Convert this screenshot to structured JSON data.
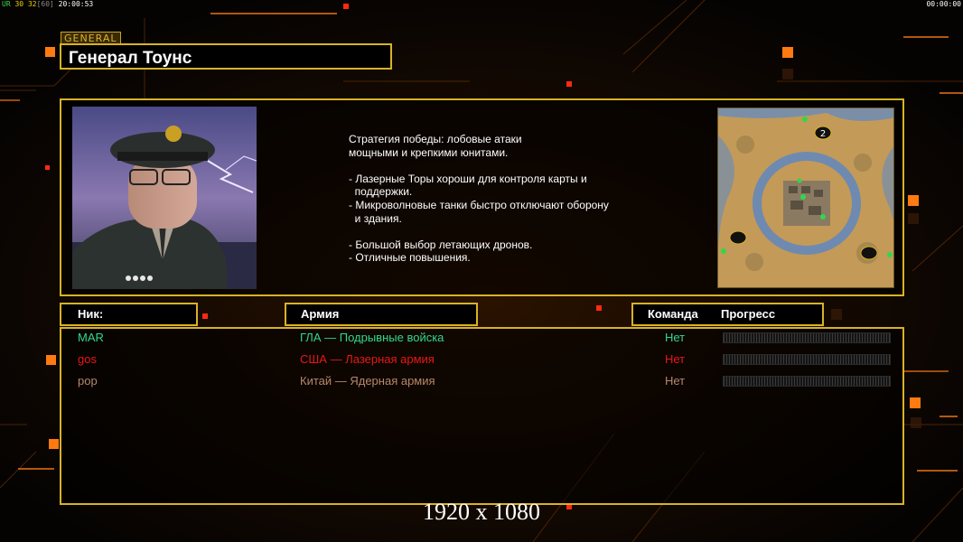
{
  "hud": {
    "fps_label": "UR",
    "fps_a": "30",
    "fps_b": "32",
    "fps_c": "[60]",
    "clock": "20:00:53",
    "timer": "00:00:00"
  },
  "general": {
    "tag": "GENERAL",
    "name": "Генерал Тоунс",
    "description": "Стратегия победы: лобовые атаки\nмощными и крепкими юнитами.\n\n- Лазерные Торы хороши для контроля карты и\n  поддержки.\n- Микроволновые танки быстро отключают оборону\n  и здания.\n\n- Большой выбор летающих дронов.\n- Отличные повышения."
  },
  "map": {
    "player_marker": "2"
  },
  "table": {
    "header_nick": "Ник:",
    "header_army": "Армия",
    "header_team": "Команда",
    "header_progress": "Прогресс"
  },
  "players": [
    {
      "nick": "MAR",
      "army": "ГЛА — Подрывные войска",
      "team": "Нет",
      "color": "#2fd88c"
    },
    {
      "nick": "gos",
      "army": "США — Лазерная армия",
      "team": "Нет",
      "color": "#e81818"
    },
    {
      "nick": "pop",
      "army": "Китай — Ядерная армия",
      "team": "Нет",
      "color": "#b8876a"
    }
  ],
  "resolution": "1920 x 1080",
  "colors": {
    "accent": "#d8b226",
    "background_glow": "#ff6a10"
  }
}
